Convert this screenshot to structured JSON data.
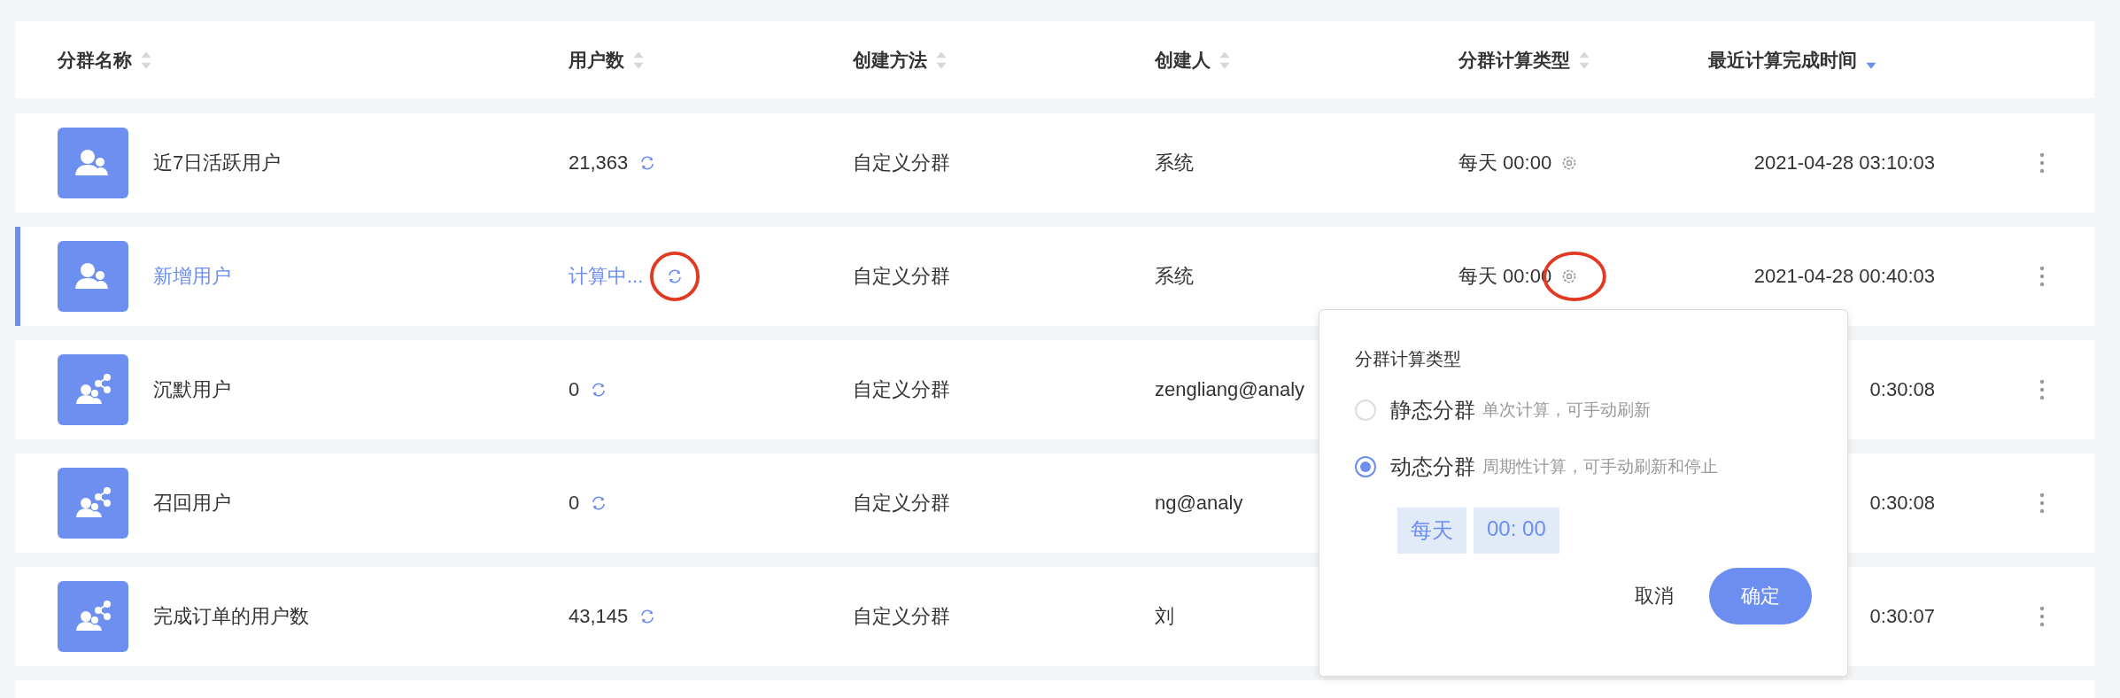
{
  "columns": [
    {
      "label": "分群名称",
      "sorted": false
    },
    {
      "label": "用户数",
      "sorted": false
    },
    {
      "label": "创建方法",
      "sorted": false
    },
    {
      "label": "创建人",
      "sorted": false
    },
    {
      "label": "分群计算类型",
      "sorted": false
    },
    {
      "label": "最近计算完成时间",
      "sorted": true
    }
  ],
  "rows": [
    {
      "kind": "group",
      "name": "近7日活跃用户",
      "users": "21,363",
      "calculating": false,
      "refresh_circled": false,
      "method": "自定义分群",
      "creator": "系统",
      "schedule": "每天 00:00",
      "gear_circled": false,
      "time": "2021-04-28 03:10:03",
      "selected": false
    },
    {
      "kind": "group",
      "name": "新增用户",
      "users": "计算中...",
      "calculating": true,
      "refresh_circled": true,
      "method": "自定义分群",
      "creator": "系统",
      "schedule": "每天 00:00",
      "gear_circled": true,
      "time": "2021-04-28 00:40:03",
      "selected": true
    },
    {
      "kind": "share",
      "name": "沉默用户",
      "users": "0",
      "calculating": false,
      "refresh_circled": false,
      "method": "自定义分群",
      "creator": "zengliang@analy",
      "time": "0:30:08",
      "selected": false
    },
    {
      "kind": "share",
      "name": "召回用户",
      "users": "0",
      "calculating": false,
      "refresh_circled": false,
      "method": "自定义分群",
      "creator": "ng@analy",
      "time": "0:30:08",
      "selected": false
    },
    {
      "kind": "share",
      "name": "完成订单的用户数",
      "users": "43,145",
      "calculating": false,
      "refresh_circled": false,
      "method": "自定义分群",
      "creator": "刘",
      "time": "0:30:07",
      "selected": false
    }
  ],
  "popup": {
    "title": "分群计算类型",
    "options": [
      {
        "label": "静态分群",
        "hint": "单次计算，可手动刷新",
        "selected": false
      },
      {
        "label": "动态分群",
        "hint": "周期性计算，可手动刷新和停止",
        "selected": true
      }
    ],
    "schedule_tags": [
      "每天",
      "00: 00"
    ],
    "cancel": "取消",
    "confirm": "确定"
  }
}
